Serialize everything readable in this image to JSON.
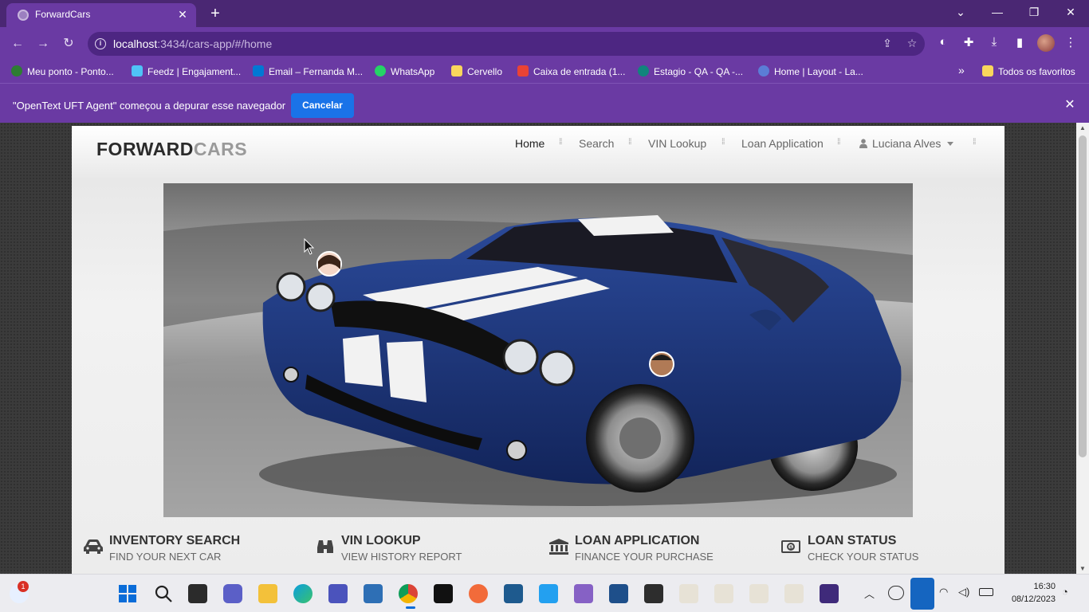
{
  "browser": {
    "tab_title": "ForwardCars",
    "url_host": "localhost",
    "url_rest": ":3434/cars-app/#/home",
    "bookmarks": [
      "Meu ponto - Ponto...",
      "Feedz | Engajament...",
      "Email – Fernanda M...",
      "WhatsApp",
      "Cervello",
      "Caixa de entrada (1...",
      "Estagio - QA - QA -...",
      "Home | Layout - La..."
    ],
    "all_bookmarks": "Todos os favoritos",
    "more_bookmarks": "»",
    "infobar_text": "\"OpenText UFT Agent\" começou a depurar esse navegador",
    "infobar_button": "Cancelar"
  },
  "site": {
    "logo_part1": "FORWARD",
    "logo_part2": "CARS",
    "menu": [
      "Home",
      "Search",
      "VIN Lookup",
      "Loan Application"
    ],
    "user_name": "Luciana Alves",
    "features": [
      {
        "title": "INVENTORY SEARCH",
        "subtitle": "FIND YOUR NEXT CAR"
      },
      {
        "title": "VIN LOOKUP",
        "subtitle": "VIEW HISTORY REPORT"
      },
      {
        "title": "LOAN APPLICATION",
        "subtitle": "FINANCE YOUR PURCHASE"
      },
      {
        "title": "LOAN STATUS",
        "subtitle": "CHECK YOUR STATUS"
      }
    ]
  },
  "taskbar": {
    "notification_badge": "1",
    "time": "16:30",
    "date": "08/12/2023"
  },
  "colors": {
    "browser_frame": "#6a3aa3",
    "title_bar": "#4a2773",
    "accent_button": "#1a73e8",
    "car_body": "#1f3b82"
  }
}
